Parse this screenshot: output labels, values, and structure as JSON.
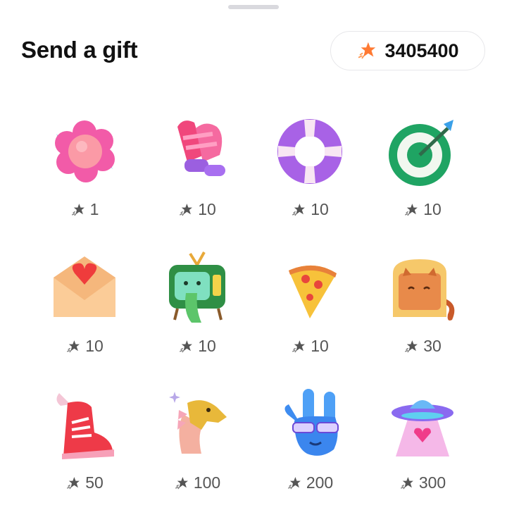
{
  "header": {
    "title": "Send a gift",
    "balance": "3405400",
    "balance_icon": "coin-burst-icon",
    "accent": "#ff7a33"
  },
  "gifts": [
    {
      "name": "flower",
      "price": "1"
    },
    {
      "name": "mittens",
      "price": "10"
    },
    {
      "name": "lifebuoy",
      "price": "10"
    },
    {
      "name": "target",
      "price": "10"
    },
    {
      "name": "love-letter",
      "price": "10"
    },
    {
      "name": "retro-tv",
      "price": "10"
    },
    {
      "name": "pizza",
      "price": "10"
    },
    {
      "name": "toast-cat",
      "price": "30"
    },
    {
      "name": "winged-sneaker",
      "price": "50"
    },
    {
      "name": "dragon",
      "price": "100"
    },
    {
      "name": "rock-hand",
      "price": "200"
    },
    {
      "name": "ufo",
      "price": "300"
    }
  ]
}
